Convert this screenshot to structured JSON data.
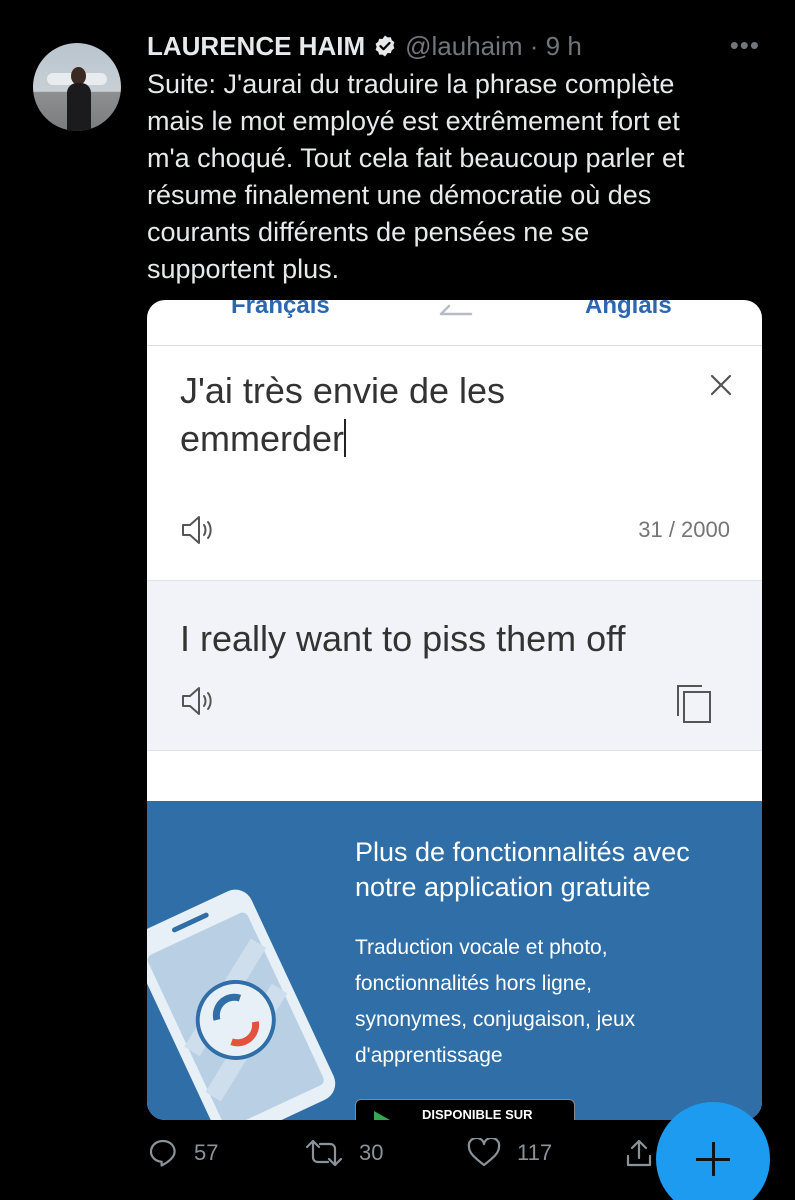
{
  "tweet": {
    "author_name": "LAURENCE HAIM",
    "handle_time": "@lauhaim · 9 h",
    "text": "Suite: J'aurai du traduire la phrase complète\nmais le mot employé  est extrêmement fort et\nm'a choqué. Tout cela fait beaucoup parler et\nrésume  finalement une démocratie où des\ncourants différents de pensées ne se\nsupportent plus.",
    "icons": {
      "verified": "verified-badge-icon",
      "more": "more-options-icon"
    }
  },
  "translator": {
    "source_lang": "Français",
    "target_lang": "Anglais",
    "source_text": "J'ai très envie de les emmerder",
    "char_count": "31 / 2000",
    "translated_text": "I really want to piss them off",
    "link_color": "#2b66b1"
  },
  "promo": {
    "title": "Plus de fonctionnalités avec notre application gratuite",
    "description": "Traduction vocale et photo, fonctionnalités hors ligne, synonymes, conjugaison, jeux d'apprentissage",
    "store_badge": "DISPONIBLE SUR",
    "background_color": "#2f6ea6"
  },
  "actions": {
    "reply_count": "57",
    "retweet_count": "30",
    "like_count": "117"
  },
  "colors": {
    "background": "#000000",
    "text": "#e7e9ea",
    "muted": "#71767b",
    "accent": "#1d9bf0"
  }
}
